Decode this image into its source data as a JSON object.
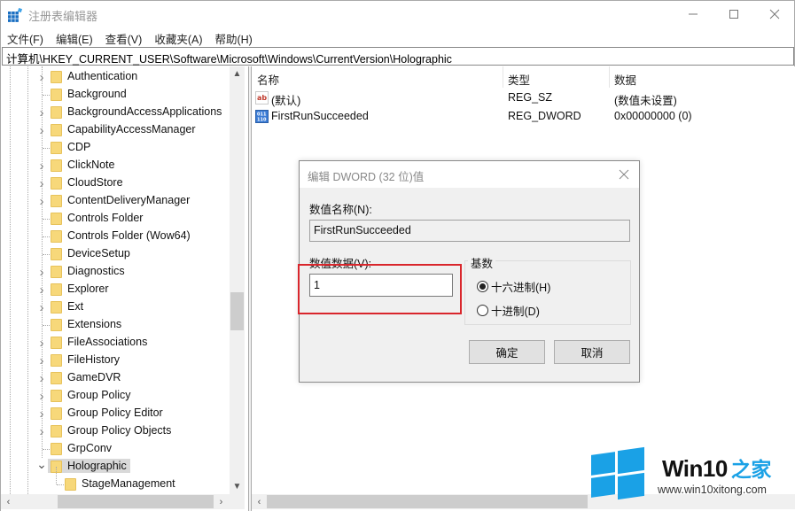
{
  "window": {
    "title": "注册表编辑器",
    "minimize_icon": "minimize-icon",
    "maximize_icon": "maximize-icon",
    "close_icon": "close-icon"
  },
  "menubar": {
    "items": [
      {
        "label": "文件(F)"
      },
      {
        "label": "编辑(E)"
      },
      {
        "label": "查看(V)"
      },
      {
        "label": "收藏夹(A)"
      },
      {
        "label": "帮助(H)"
      }
    ]
  },
  "address": {
    "path": "计算机\\HKEY_CURRENT_USER\\Software\\Microsoft\\Windows\\CurrentVersion\\Holographic"
  },
  "tree": {
    "items": [
      {
        "label": "Authentication",
        "expandable": true
      },
      {
        "label": "Background",
        "expandable": false
      },
      {
        "label": "BackgroundAccessApplications",
        "expandable": true
      },
      {
        "label": "CapabilityAccessManager",
        "expandable": true
      },
      {
        "label": "CDP",
        "expandable": false
      },
      {
        "label": "ClickNote",
        "expandable": true
      },
      {
        "label": "CloudStore",
        "expandable": true
      },
      {
        "label": "ContentDeliveryManager",
        "expandable": true
      },
      {
        "label": "Controls Folder",
        "expandable": false
      },
      {
        "label": "Controls Folder (Wow64)",
        "expandable": false
      },
      {
        "label": "DeviceSetup",
        "expandable": false
      },
      {
        "label": "Diagnostics",
        "expandable": true
      },
      {
        "label": "Explorer",
        "expandable": true
      },
      {
        "label": "Ext",
        "expandable": true
      },
      {
        "label": "Extensions",
        "expandable": false
      },
      {
        "label": "FileAssociations",
        "expandable": true
      },
      {
        "label": "FileHistory",
        "expandable": true
      },
      {
        "label": "GameDVR",
        "expandable": true
      },
      {
        "label": "Group Policy",
        "expandable": true
      },
      {
        "label": "Group Policy Editor",
        "expandable": true
      },
      {
        "label": "Group Policy Objects",
        "expandable": true
      },
      {
        "label": "GrpConv",
        "expandable": false
      },
      {
        "label": "Holographic",
        "expandable": true,
        "expanded": true,
        "selected": true
      },
      {
        "label": "StageManagement",
        "expandable": false,
        "child": true
      }
    ]
  },
  "list": {
    "columns": [
      "名称",
      "类型",
      "数据"
    ],
    "rows": [
      {
        "icon": "string-value-icon",
        "icon_text": "ab",
        "name": "(默认)",
        "type": "REG_SZ",
        "data": "(数值未设置)"
      },
      {
        "icon": "binary-value-icon",
        "icon_text": "011 110",
        "name": "FirstRunSucceeded",
        "type": "REG_DWORD",
        "data": "0x00000000 (0)"
      }
    ]
  },
  "dialog": {
    "title": "编辑 DWORD (32 位)值",
    "name_label": "数值名称(N):",
    "name_value": "FirstRunSucceeded",
    "data_label": "数值数据(V):",
    "data_value": "1",
    "base_label": "基数",
    "radio_hex": "十六进制(H)",
    "radio_dec": "十进制(D)",
    "selected_base": "hex",
    "ok_label": "确定",
    "cancel_label": "取消"
  },
  "watermark": {
    "title": "Win10",
    "title_cn": "之家",
    "url": "www.win10xitong.com",
    "brand_color": "#1aa1e6"
  },
  "colors": {
    "highlight_box": "#d9262c",
    "folder": "#f7d87a",
    "selected_bg": "#d9d9d9"
  }
}
